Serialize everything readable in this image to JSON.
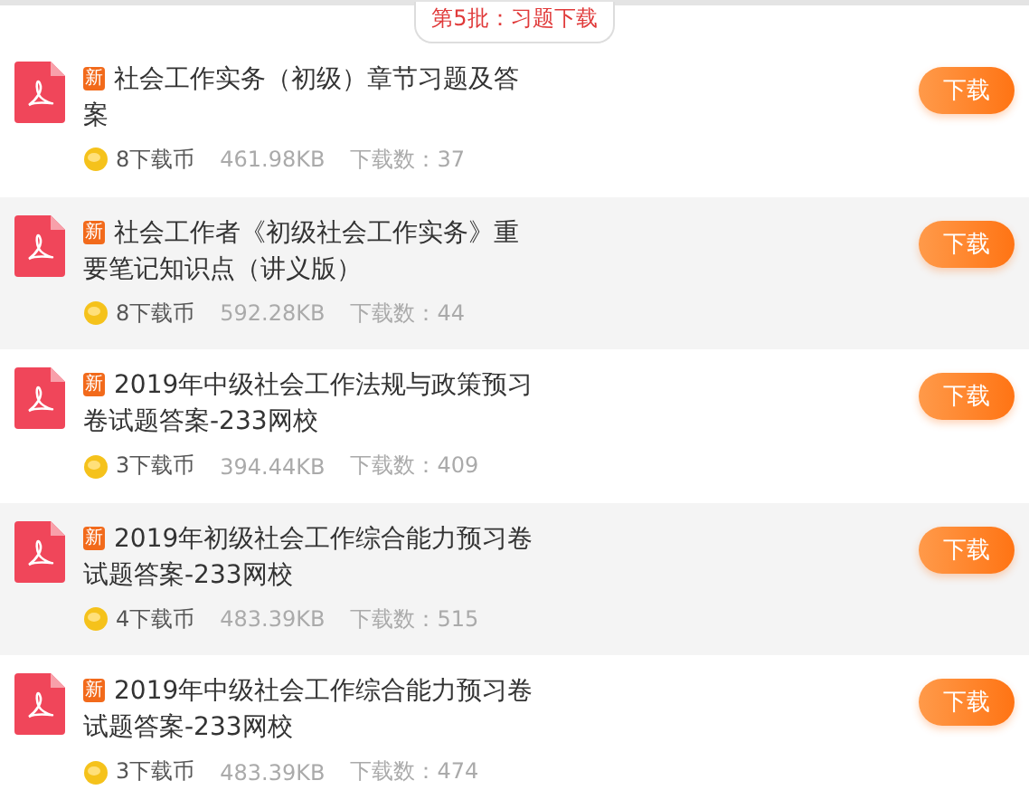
{
  "header": {
    "label": "第5批：习题下载"
  },
  "files": [
    {
      "badge": "新",
      "title": "社会工作实务（初级）章节习题及答案",
      "coins": "8下载币",
      "size": "461.98KB",
      "downloads": "下载数：37",
      "button": "下载"
    },
    {
      "badge": "新",
      "title": "社会工作者《初级社会工作实务》重要笔记知识点（讲义版）",
      "coins": "8下载币",
      "size": "592.28KB",
      "downloads": "下载数：44",
      "button": "下载"
    },
    {
      "badge": "新",
      "title": "2019年中级社会工作法规与政策预习卷试题答案-233网校",
      "coins": "3下载币",
      "size": "394.44KB",
      "downloads": "下载数：409",
      "button": "下载"
    },
    {
      "badge": "新",
      "title": "2019年初级社会工作综合能力预习卷试题答案-233网校",
      "coins": "4下载币",
      "size": "483.39KB",
      "downloads": "下载数：515",
      "button": "下载"
    },
    {
      "badge": "新",
      "title": "2019年中级社会工作综合能力预习卷试题答案-233网校",
      "coins": "3下载币",
      "size": "483.39KB",
      "downloads": "下载数：474",
      "button": "下载"
    }
  ]
}
